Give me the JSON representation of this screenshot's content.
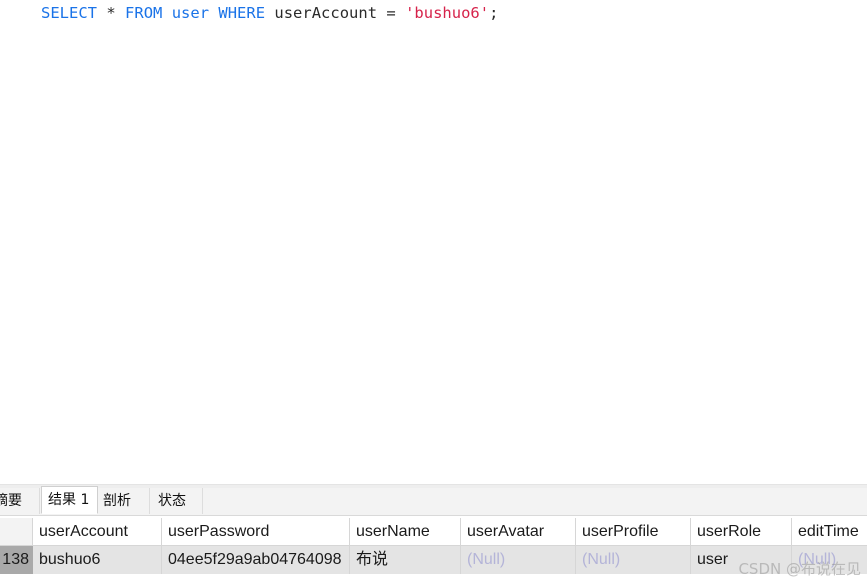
{
  "editor": {
    "sql": {
      "kw_select": "SELECT",
      "star": "*",
      "kw_from": "FROM",
      "table": "user",
      "kw_where": "WHERE",
      "column": "userAccount",
      "eq": "=",
      "value": "'bushuo6'",
      "semicolon": ";"
    }
  },
  "tabs": [
    {
      "label": "摘要"
    },
    {
      "label": "结果 1",
      "active": true
    },
    {
      "label": "剖析"
    },
    {
      "label": "状态"
    }
  ],
  "grid": {
    "columns": [
      "userAccount",
      "userPassword",
      "userName",
      "userAvatar",
      "userProfile",
      "userRole",
      "editTime"
    ],
    "row": {
      "row_id": "138",
      "cells": [
        "bushuo6",
        "04ee5f29a9ab04764098",
        "布说",
        "(Null)",
        "(Null)",
        "user",
        "(Null)"
      ]
    }
  },
  "watermark": "CSDN @布说在见",
  "colors": {
    "keyword": "#1a73e8",
    "string": "#d6224a",
    "null_text": "#b4b4d8",
    "row_bg": "#e4e4e4"
  }
}
